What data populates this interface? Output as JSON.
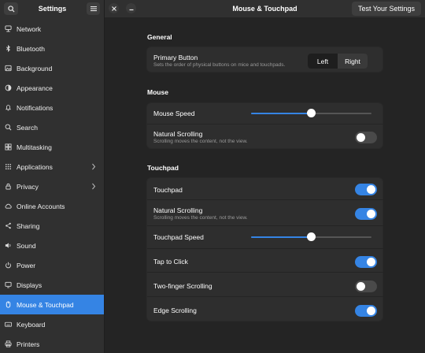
{
  "header": {
    "sidebar_title": "Settings",
    "main_title": "Mouse & Touchpad",
    "test_button": "Test Your Settings"
  },
  "sidebar": {
    "items": [
      {
        "label": "Network",
        "icon": "network-icon"
      },
      {
        "label": "Bluetooth",
        "icon": "bluetooth-icon"
      },
      {
        "label": "Background",
        "icon": "background-icon"
      },
      {
        "label": "Appearance",
        "icon": "appearance-icon"
      },
      {
        "label": "Notifications",
        "icon": "bell-icon"
      },
      {
        "label": "Search",
        "icon": "search-icon"
      },
      {
        "label": "Multitasking",
        "icon": "multitasking-icon"
      },
      {
        "label": "Applications",
        "icon": "applications-icon"
      },
      {
        "label": "Privacy",
        "icon": "privacy-icon"
      },
      {
        "label": "Online Accounts",
        "icon": "online-accounts-icon"
      },
      {
        "label": "Sharing",
        "icon": "sharing-icon"
      },
      {
        "label": "Sound",
        "icon": "sound-icon"
      },
      {
        "label": "Power",
        "icon": "power-icon"
      },
      {
        "label": "Displays",
        "icon": "displays-icon"
      },
      {
        "label": "Mouse & Touchpad",
        "icon": "mouse-icon"
      },
      {
        "label": "Keyboard",
        "icon": "keyboard-icon"
      },
      {
        "label": "Printers",
        "icon": "printer-icon"
      }
    ]
  },
  "general": {
    "title": "General",
    "primary_button": {
      "label": "Primary Button",
      "subtitle": "Sets the order of physical buttons on mice and touchpads.",
      "left": "Left",
      "right": "Right",
      "selected": "Left"
    }
  },
  "mouse": {
    "title": "Mouse",
    "speed_label": "Mouse Speed",
    "speed_value": 0.5,
    "natural_scrolling": {
      "label": "Natural Scrolling",
      "subtitle": "Scrolling moves the content, not the view.",
      "enabled": false
    }
  },
  "touchpad": {
    "title": "Touchpad",
    "touchpad": {
      "label": "Touchpad",
      "enabled": true
    },
    "natural_scrolling": {
      "label": "Natural Scrolling",
      "subtitle": "Scrolling moves the content, not the view.",
      "enabled": true
    },
    "speed_label": "Touchpad Speed",
    "speed_value": 0.5,
    "tap_to_click": {
      "label": "Tap to Click",
      "enabled": true
    },
    "two_finger": {
      "label": "Two-finger Scrolling",
      "enabled": false
    },
    "edge": {
      "label": "Edge Scrolling",
      "enabled": true
    }
  },
  "colors": {
    "accent": "#3584e4",
    "sidebar_bg": "#303030",
    "main_bg": "#242424",
    "card_bg": "#2e2e2e"
  }
}
